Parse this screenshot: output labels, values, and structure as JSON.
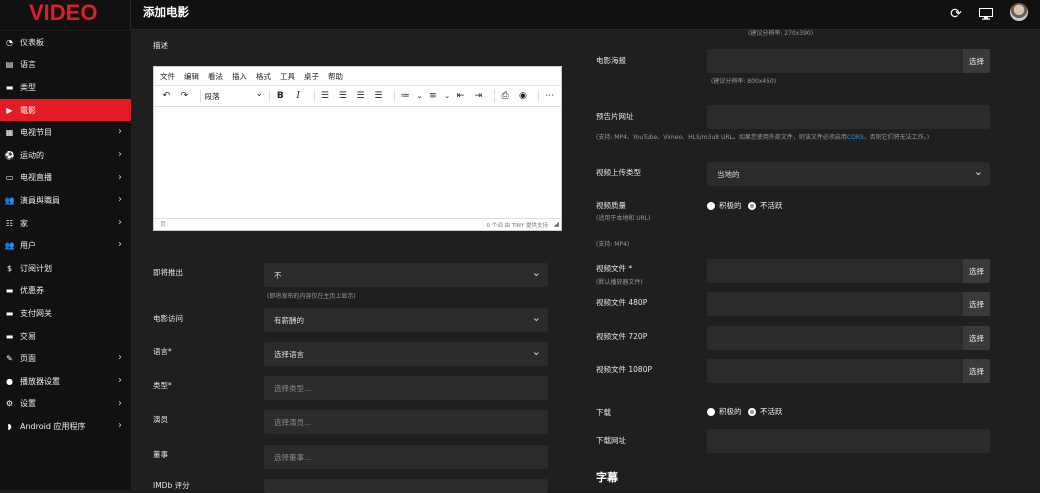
{
  "app": {
    "logo": "VIDEO",
    "page_title": "添加电影"
  },
  "topbar": {
    "refresh_icon": "refresh-icon",
    "monitor_icon": "monitor-icon"
  },
  "sidebar": {
    "items": [
      {
        "label": "仪表板",
        "icon": "dashboard-icon",
        "chevron": false,
        "active": false
      },
      {
        "label": "语言",
        "icon": "language-icon",
        "chevron": false,
        "active": false
      },
      {
        "label": "类型",
        "icon": "genre-icon",
        "chevron": false,
        "active": false
      },
      {
        "label": "電影",
        "icon": "movie-icon",
        "chevron": false,
        "active": true
      },
      {
        "label": "电视节目",
        "icon": "tv-show-icon",
        "chevron": true,
        "active": false
      },
      {
        "label": "运动的",
        "icon": "sports-icon",
        "chevron": true,
        "active": false
      },
      {
        "label": "电视直播",
        "icon": "live-tv-icon",
        "chevron": true,
        "active": false
      },
      {
        "label": "演員與職員",
        "icon": "cast-icon",
        "chevron": true,
        "active": false
      },
      {
        "label": "家",
        "icon": "home-sliders-icon",
        "chevron": true,
        "active": false
      },
      {
        "label": "用户",
        "icon": "users-icon",
        "chevron": true,
        "active": false
      },
      {
        "label": "订阅计划",
        "icon": "dollar-icon",
        "chevron": false,
        "active": false
      },
      {
        "label": "优惠券",
        "icon": "coupon-icon",
        "chevron": false,
        "active": false
      },
      {
        "label": "支付网关",
        "icon": "payment-icon",
        "chevron": false,
        "active": false
      },
      {
        "label": "交易",
        "icon": "transactions-icon",
        "chevron": false,
        "active": false
      },
      {
        "label": "页面",
        "icon": "pages-icon",
        "chevron": true,
        "active": false
      },
      {
        "label": "播放器设置",
        "icon": "player-icon",
        "chevron": true,
        "active": false
      },
      {
        "label": "设置",
        "icon": "settings-icon",
        "chevron": true,
        "active": false
      },
      {
        "label": "Android 应用程序",
        "icon": "android-icon",
        "chevron": true,
        "active": false
      }
    ]
  },
  "left": {
    "description_label": "描述",
    "editor": {
      "menu": [
        "文件",
        "编辑",
        "看法",
        "插入",
        "格式",
        "工具",
        "桌子",
        "帮助"
      ],
      "paragraph": "段落",
      "status_left": "页",
      "status_right": "0 个词  由 TINY 提供支持"
    },
    "coming_soon": {
      "label": "即将推出",
      "value": "不",
      "hint": "(即将发布的内容仅在主页上显示)"
    },
    "movie_access": {
      "label": "电影访问",
      "value": "有薪酬的"
    },
    "language": {
      "label": "语言*",
      "value": "选择语言"
    },
    "genre": {
      "label": "类型*",
      "placeholder": "选择类型..."
    },
    "actors": {
      "label": "演员",
      "placeholder": "选择演员..."
    },
    "director": {
      "label": "董事",
      "placeholder": "选择董事..."
    },
    "imdb": {
      "label": "IMDb 评分"
    }
  },
  "right": {
    "top_hint": "(建议分辨率: 270x390)",
    "poster": {
      "label": "电影海报",
      "button": "选择",
      "hint": "(建议分辨率: 800x450)"
    },
    "trailer": {
      "label": "预告片网址",
      "hint_pre": "(支持: MP4、YouTube、Vimeo、HLS/m3u8 URL。如果您使用外部文件，则该文件必须启用",
      "hint_link": "CORS",
      "hint_post": "，否则它们将无法工作。)"
    },
    "upload_type": {
      "label": "视频上传类型",
      "value": "当地的"
    },
    "quality": {
      "label": "视频质量",
      "sub": "(适用于本地和 URL)",
      "opt1": "积极的",
      "opt2": "不活跃",
      "support": "(支持: MP4)"
    },
    "video_file": {
      "label": "视频文件 *",
      "sub": "(默认播放器文件)",
      "button": "选择"
    },
    "file480": {
      "label": "视频文件 480P",
      "button": "选择"
    },
    "file720": {
      "label": "视频文件 720P",
      "button": "选择"
    },
    "file1080": {
      "label": "视频文件 1080P",
      "button": "选择"
    },
    "download": {
      "label": "下载",
      "opt1": "积极的",
      "opt2": "不活跃"
    },
    "download_url": {
      "label": "下载网址"
    },
    "subtitle_heading": "字幕"
  }
}
